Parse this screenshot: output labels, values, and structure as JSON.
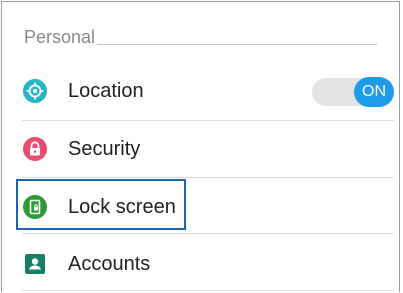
{
  "section": {
    "title": "Personal"
  },
  "settings": {
    "items": [
      {
        "label": "Location",
        "icon": "location-crosshair-icon",
        "icon_color": "#26b5c8"
      },
      {
        "label": "Security",
        "icon": "lock-icon",
        "icon_color": "#e84c6e"
      },
      {
        "label": "Lock screen",
        "icon": "lock-screen-phone-icon",
        "icon_color": "#2e9a35"
      },
      {
        "label": "Accounts",
        "icon": "account-card-icon",
        "icon_color": "#1a7f68"
      }
    ],
    "location_toggle": {
      "state_label": "ON",
      "on": true,
      "accent": "#1e9be9"
    }
  },
  "highlight": {
    "target": "Lock screen",
    "color": "#1f63a8"
  }
}
